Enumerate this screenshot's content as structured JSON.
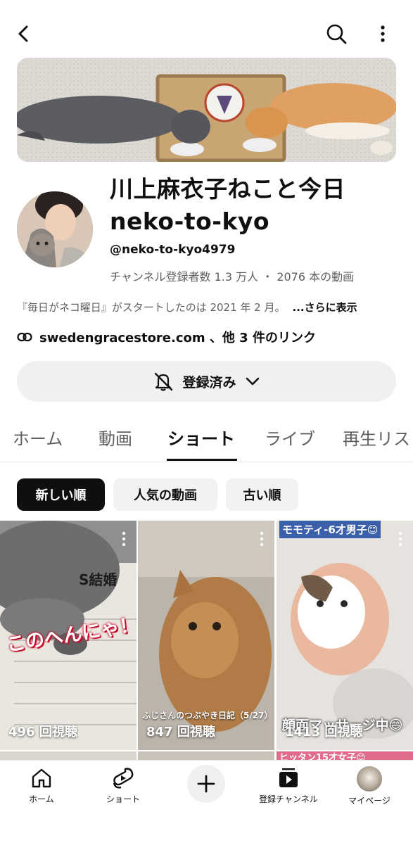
{
  "channel": {
    "name_line1": "川上麻衣子ねこと今日",
    "name_line2": "neko-to-kyo",
    "handle": "@neko-to-kyo4979",
    "stats": "チャンネル登録者数 1.3 万人 ・ 2076 本の動画",
    "description": "『毎日がネコ曜日』がスタートしたのは 2021 年 2 月。",
    "show_more": "...さらに表示",
    "links": "swedengracestore.com 、他 3 件のリンク",
    "subscribe_label": "登録済み"
  },
  "tabs": [
    {
      "label": "ホーム"
    },
    {
      "label": "動画"
    },
    {
      "label": "ショート"
    },
    {
      "label": "ライブ"
    },
    {
      "label": "再生リス"
    }
  ],
  "filters": [
    {
      "label": "新しい順"
    },
    {
      "label": "人気の動画"
    },
    {
      "label": "古い順"
    }
  ],
  "shorts": [
    {
      "overlay": "S結婚",
      "caption": "このへんにゃ！",
      "views": "496 回視聴"
    },
    {
      "caption": "ふじさんのつぶやき日記（5/27）",
      "views": "847 回視聴"
    },
    {
      "top_caption": "モモティ-6才男子😊",
      "caption": "顔面マッサージ中😄",
      "views": "1413 回視聴"
    }
  ],
  "bottom_nav": [
    {
      "label": "ホーム",
      "icon": "home-icon"
    },
    {
      "label": "ショート",
      "icon": "shorts-icon"
    },
    {
      "label": "",
      "icon": "create-icon"
    },
    {
      "label": "登録チャンネル",
      "icon": "subscriptions-icon"
    },
    {
      "label": "マイページ",
      "icon": "avatar"
    }
  ],
  "bottom_peek": {
    "right_caption": "ヒッタン15才女子😊"
  }
}
